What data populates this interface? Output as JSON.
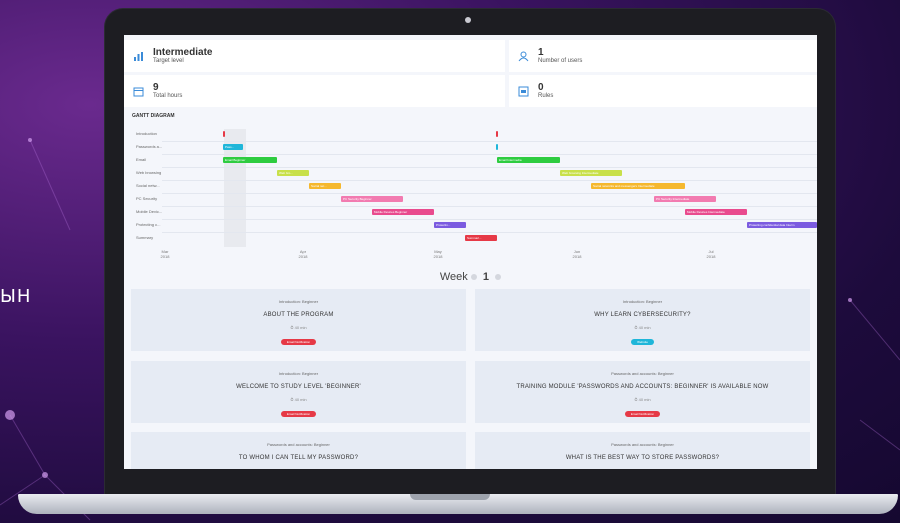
{
  "side_text": "ЫН",
  "stats": [
    {
      "value": "Intermediate",
      "label": "Target level",
      "icon": "bar-chart-icon"
    },
    {
      "value": "1",
      "label": "Number of users",
      "icon": "users-icon"
    },
    {
      "value": "9",
      "label": "Total hours",
      "icon": "calendar-icon"
    },
    {
      "value": "0",
      "label": "Rules",
      "icon": "rules-icon"
    }
  ],
  "gantt": {
    "title": "GANTT DIAGRAM",
    "rows": [
      "Introduction",
      "Passwords a...",
      "Email",
      "Web browsing",
      "Social netw...",
      "PC Security",
      "Mobile Devic...",
      "Protecting c...",
      "Summary"
    ],
    "ticks": [
      "Mar\n2018",
      "Apr\n2018",
      "May\n2018",
      "Jun\n2018",
      "Jul\n2018"
    ],
    "bar_labels": {
      "pass_short": "Pass...",
      "email_b": "Email Beginner",
      "web_b": "Web bro...",
      "social_b": "Social net...",
      "pc_b": "PC Security Beginner",
      "mobile_b": "Mobile Devices Beginner",
      "protect_b": "Protectin...",
      "summary_b": "Summari...",
      "email_i": "Email Intermedia",
      "web_i": "Web browsing Intermediate",
      "social_i": "Social networks and messengers Intermediate",
      "pc_i": "PC Security Intermediate",
      "mobile_i": "Mobile Devices Intermediate",
      "protect_i": "Protecting confidential data Interm"
    }
  },
  "week": {
    "label": "Week",
    "number": "1"
  },
  "cards": [
    {
      "category": "Introduction: Beginner",
      "title": "ABOUT THE PROGRAM",
      "time": "⏱ 40 min",
      "badge": "Email Notification",
      "badge_color": "#e63946"
    },
    {
      "category": "Introduction: Beginner",
      "title": "WHY LEARN CYBERSECURITY?",
      "time": "⏱ 40 min",
      "badge": "Website",
      "badge_color": "#1fb6d9"
    },
    {
      "category": "Introduction: Beginner",
      "title": "WELCOME TO STUDY LEVEL 'BEGINNER'",
      "time": "⏱ 40 min",
      "badge": "Email Notification",
      "badge_color": "#e63946"
    },
    {
      "category": "Passwords and accounts: Beginner",
      "title": "TRAINING MODULE 'PASSWORDS AND ACCOUNTS: BEGINNER' IS AVAILABLE NOW",
      "time": "⏱ 40 min",
      "badge": "Email Notification",
      "badge_color": "#e63946"
    },
    {
      "category": "Passwords and accounts: Beginner",
      "title": "TO WHOM I CAN TELL MY PASSWORD?",
      "time": "",
      "badge": "",
      "badge_color": "#e63946"
    },
    {
      "category": "Passwords and accounts: Beginner",
      "title": "WHAT IS THE BEST WAY TO STORE PASSWORDS?",
      "time": "",
      "badge": "",
      "badge_color": "#e63946"
    }
  ]
}
